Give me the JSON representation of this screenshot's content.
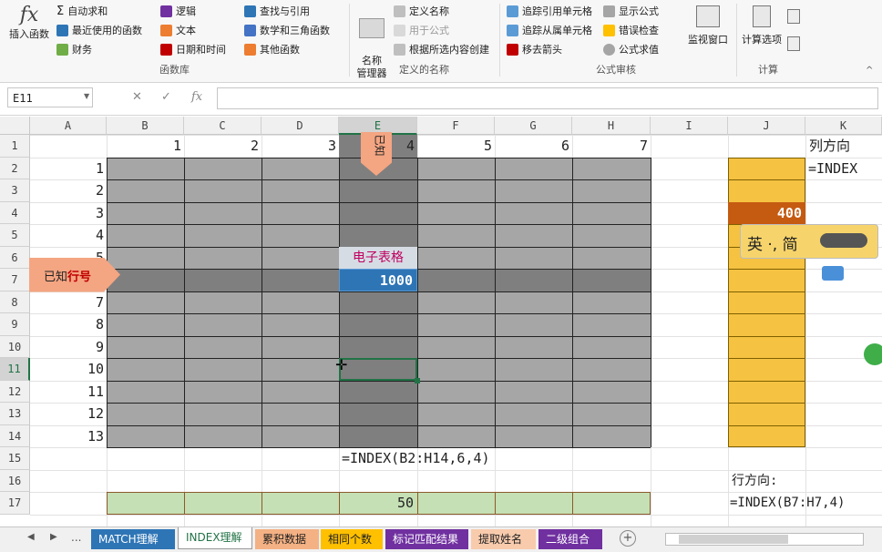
{
  "ribbon": {
    "insert_function": "插入函数",
    "autosum": "自动求和",
    "recent": "最近使用的函数",
    "financial": "财务",
    "logical": "逻辑",
    "text": "文本",
    "datetime": "日期和时间",
    "lookup": "查找与引用",
    "math": "数学和三角函数",
    "other": "其他函数",
    "group_library": "函数库",
    "name_manager": "名称\n管理器",
    "define_name": "定义名称",
    "use_in_formula": "用于公式",
    "create_from_sel": "根据所选内容创建",
    "group_names": "定义的名称",
    "trace_precedents": "追踪引用单元格",
    "trace_dependents": "追踪从属单元格",
    "remove_arrows": "移去箭头",
    "show_formulas": "显示公式",
    "error_check": "错误检查",
    "evaluate": "公式求值",
    "group_audit": "公式审核",
    "watch_window": "监视窗口",
    "calc_options": "计算选项",
    "group_calc": "计算"
  },
  "formula_bar": {
    "name_box": "E11",
    "formula": ""
  },
  "columns": [
    "A",
    "B",
    "C",
    "D",
    "E",
    "F",
    "G",
    "H",
    "I",
    "J",
    "K"
  ],
  "rows": [
    "1",
    "2",
    "3",
    "4",
    "5",
    "6",
    "7",
    "8",
    "9",
    "10",
    "11",
    "12",
    "13",
    "14",
    "15",
    "16",
    "17"
  ],
  "header_row_values": [
    "1",
    "2",
    "3",
    "4",
    "5",
    "6",
    "7"
  ],
  "row_labels": [
    "1",
    "2",
    "3",
    "4",
    "5",
    "6",
    "7",
    "8",
    "9",
    "10",
    "11",
    "12",
    "13"
  ],
  "cells": {
    "e6_label": "电子表格",
    "e7_value": "1000",
    "j4_value": "400",
    "e15_formula": "=INDEX(B2:H14,6,4)",
    "e17_value": "50",
    "j16_label": "行方向:",
    "j17_formula": "=INDEX(B7:H7,4)",
    "k1_label": "列方向",
    "k2_formula": "=INDEX"
  },
  "callouts": {
    "col_known": "已知",
    "row_known_prefix": "已知",
    "row_known_suffix": "行号",
    "ime_text": "英 ·, 简"
  },
  "sheet_tabs": [
    {
      "label": "MATCH理解",
      "bg": "#2e75b6",
      "fg": "#ffffff"
    },
    {
      "label": "INDEX理解",
      "bg": "#ffffff",
      "fg": "#217346"
    },
    {
      "label": "累积数据",
      "bg": "#f4b183",
      "fg": "#222222"
    },
    {
      "label": "相同个数",
      "bg": "#ffc000",
      "fg": "#222222"
    },
    {
      "label": "标记匹配结果",
      "bg": "#7030a0",
      "fg": "#ffffff"
    },
    {
      "label": "提取姓名",
      "bg": "#f8cbad",
      "fg": "#222222"
    },
    {
      "label": "二级组合",
      "bg": "#7030a0",
      "fg": "#ffffff"
    }
  ],
  "tab_nav": {
    "ellipsis": "..."
  },
  "colors": {
    "grey_block": "#a6a6a6",
    "dark_band": "#7f7f7f",
    "gold": "#f5c242",
    "orange_dark": "#c55a11",
    "green_light": "#c5e0b4",
    "blue_cell": "#2e75b6"
  }
}
